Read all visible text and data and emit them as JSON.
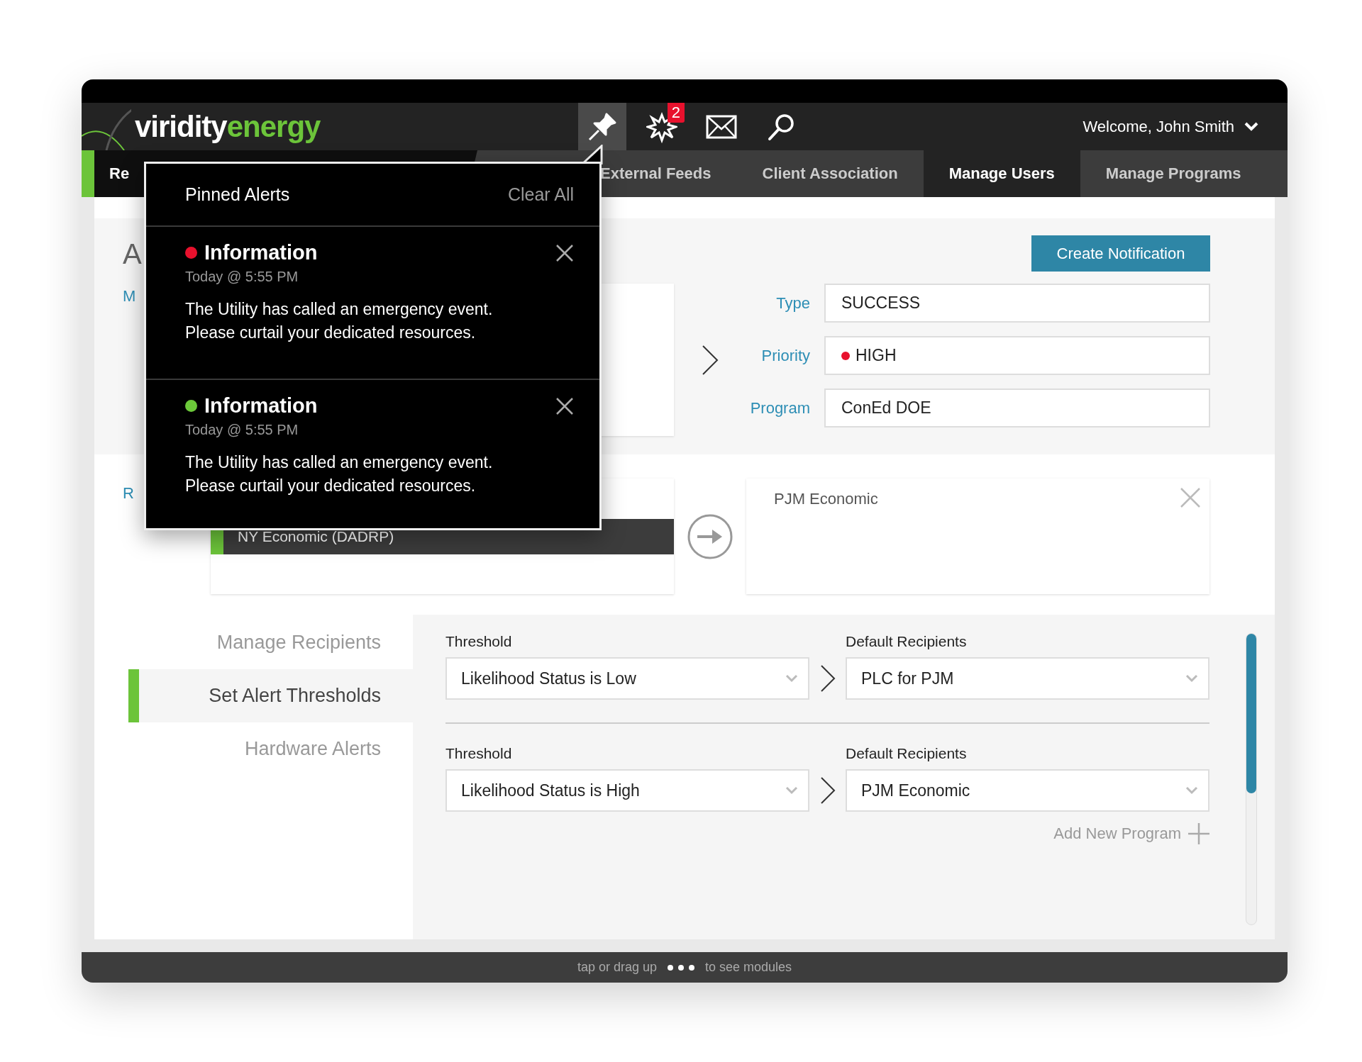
{
  "header": {
    "logo": {
      "part_1": "viridity",
      "part_2": "energy"
    },
    "alerts_badge": "2",
    "welcome": "Welcome, John Smith"
  },
  "nav": {
    "tabs": [
      {
        "label": "Re",
        "selected": false
      },
      {
        "label": "External Feeds",
        "selected": false
      },
      {
        "label": "Client Association",
        "selected": false
      },
      {
        "label": "Manage Users",
        "selected": true
      },
      {
        "label": "Manage Programs",
        "selected": false
      }
    ]
  },
  "pinned_alerts": {
    "title": "Pinned Alerts",
    "clear_all": "Clear All",
    "alerts": [
      {
        "title": "Information",
        "color": "#e8112d",
        "time": "Today @ 5:55 PM",
        "message": "The Utility has called an emergency event. Please curtail your dedicated resources."
      },
      {
        "title": "Information",
        "color": "#6cc93a",
        "time": "Today @ 5:55 PM",
        "message": "The Utility has called an emergency event. Please curtail your dedicated resources."
      }
    ]
  },
  "page": {
    "heading": "A",
    "link": "M",
    "section_label": "R"
  },
  "notification": {
    "create_button": "Create  Notification",
    "fields": [
      {
        "label": "Type",
        "value": "SUCCESS"
      },
      {
        "label": "Priority",
        "value": "HIGH",
        "color": "#e8112d"
      },
      {
        "label": "Program",
        "value": "ConEd DOE"
      }
    ]
  },
  "programs": {
    "selected_item": "NY Economic (DADRP)",
    "target": "PJM Economic"
  },
  "settings_menu": [
    {
      "label": "Manage Recipients",
      "selected": false
    },
    {
      "label": "Set Alert Thresholds",
      "selected": true
    },
    {
      "label": "Hardware Alerts",
      "selected": false
    }
  ],
  "thresholds": [
    {
      "threshold_label": "Threshold",
      "threshold": "Likelihood Status is Low",
      "recipients_label": "Default Recipients",
      "recipients": "PLC for PJM"
    },
    {
      "threshold_label": "Threshold",
      "threshold": "Likelihood Status is High",
      "recipients_label": "Default Recipients",
      "recipients": "PJM Economic"
    }
  ],
  "add_program": "Add New Program",
  "footer": {
    "text_before": "tap or drag up",
    "text_after": "to see modules"
  }
}
